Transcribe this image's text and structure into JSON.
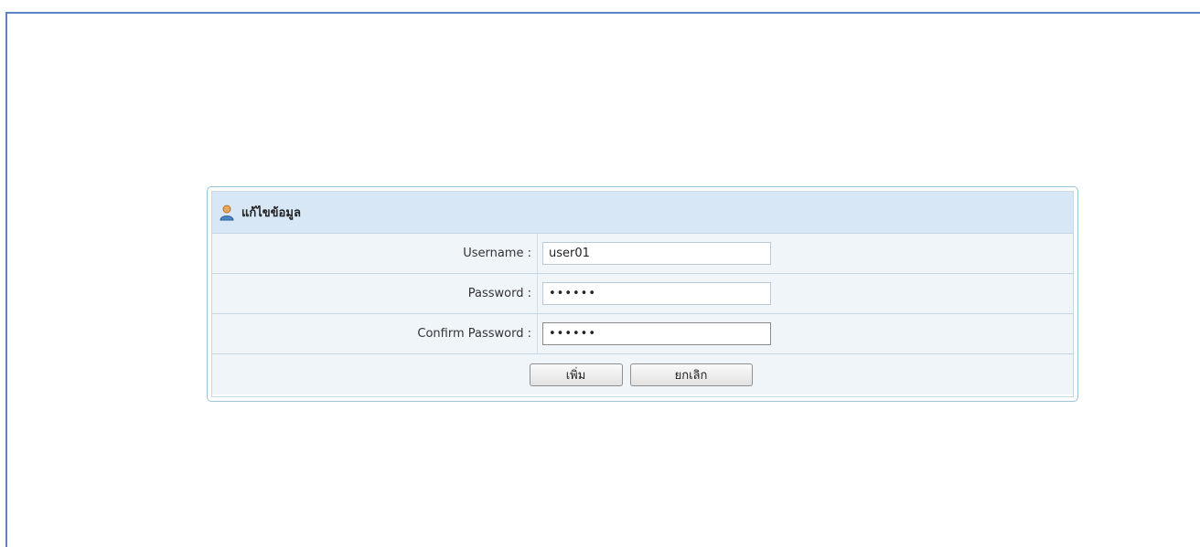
{
  "panel": {
    "title": "แก้ไขข้อมูล",
    "icon": "user-icon"
  },
  "form": {
    "username": {
      "label": "Username :",
      "value": "user01"
    },
    "password": {
      "label": "Password :",
      "value": "••••••"
    },
    "confirm_password": {
      "label": "Confirm Password :",
      "value": "••••••"
    }
  },
  "buttons": {
    "add_label": "เพิ่ม",
    "cancel_label": "ยกเลิก"
  },
  "colors": {
    "frame_border": "#5b84c4",
    "header_bg": "#d7e7f6",
    "row_bg": "#f0f5fa",
    "panel_border": "#9cc3d6"
  }
}
